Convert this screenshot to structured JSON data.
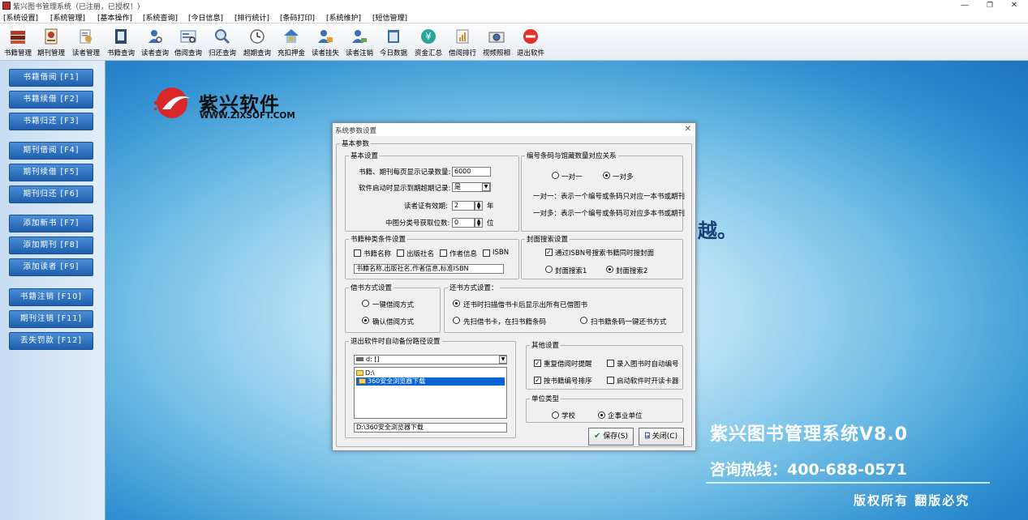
{
  "window": {
    "title": "紫兴图书管理系统（已注册，已授权！）",
    "minimize_glyph": "—",
    "restore_glyph": "❐",
    "close_glyph": "✕"
  },
  "menu": [
    "[系统设置]",
    "[系统管理]",
    "[基本操作]",
    "[系统查询]",
    "[今日信息]",
    "[排行统计]",
    "[条码打印]",
    "[系统维护]",
    "[短信管理]"
  ],
  "toolbar": [
    {
      "label": "书籍管理",
      "icon": "books-icon"
    },
    {
      "label": "期刊管理",
      "icon": "magazine-icon"
    },
    {
      "label": "读者管理",
      "icon": "reader-icon"
    },
    {
      "label": "书籍查询",
      "icon": "book-search-icon"
    },
    {
      "label": "读者查询",
      "icon": "user-search-icon"
    },
    {
      "label": "借阅查询",
      "icon": "borrow-search-icon"
    },
    {
      "label": "归还查询",
      "icon": "magnifier-icon"
    },
    {
      "label": "超期查询",
      "icon": "clock-icon"
    },
    {
      "label": "充扣押金",
      "icon": "money-house-icon"
    },
    {
      "label": "读者挂失",
      "icon": "user-lock-icon"
    },
    {
      "label": "读者注销",
      "icon": "user-cancel-icon"
    },
    {
      "label": "今日数据",
      "icon": "calendar-icon"
    },
    {
      "label": "资金汇总",
      "icon": "yen-icon"
    },
    {
      "label": "借阅排行",
      "icon": "ranking-icon"
    },
    {
      "label": "视频照相",
      "icon": "camera-icon"
    },
    {
      "label": "退出软件",
      "icon": "exit-icon"
    }
  ],
  "shortcuts": [
    "书籍借阅 [F1]",
    "书籍续借 [F2]",
    "书籍归还 [F3]",
    "期刊借阅 [F4]",
    "期刊续借 [F5]",
    "期刊归还 [F6]",
    "添加新书 [F7]",
    "添加期刊 [F8]",
    "添加读者 [F9]",
    "书籍注销 [F10]",
    "期刊注销 [F11]",
    "丢失罚款 [F12]"
  ],
  "background": {
    "logo_name": "紫兴软件",
    "logo_url": "WWW.ZIXSOFT.COM",
    "fragment": "越。",
    "product_title": "紫兴图书管理系统V8.0",
    "hotline": "咨询热线：400-688-0571",
    "copyright": "版权所有  翻版必究"
  },
  "dialog": {
    "title": "系统参数设置",
    "close_glyph": "✕",
    "basic_legend": "基本参数",
    "basic_settings": {
      "legend": "基本设置",
      "page_count_label": "书籍、期刊每页显示记录数量:",
      "page_count_value": "6000",
      "show_overdue_label": "软件启动时显示到期超期记录:",
      "show_overdue_value": "是",
      "valid_years_label": "读者证有效期:",
      "valid_years_value": "2",
      "valid_years_unit": "年",
      "class_digits_label": "中图分类号获取位数:",
      "class_digits_value": "0",
      "class_digits_unit": "位"
    },
    "barcode_mapping": {
      "legend": "编号条码与馆藏数量对应关系",
      "one_to_one": "一对一",
      "one_to_many": "一对多",
      "desc_one": "一对一：表示一个编号或条码只对应一本书或期刊",
      "desc_many": "一对多：表示一个编号或条码可对应多本书或期刊"
    },
    "book_type": {
      "legend": "书籍种类条件设置",
      "options": [
        "书籍名称",
        "出版社名",
        "作者信息",
        "ISBN"
      ],
      "value": "书籍名称,出版社名,作者信息,标准ISBN"
    },
    "cover": {
      "legend": "封面搜索设置",
      "isbn_search": "通过ISBN号搜索书籍同时搜封面",
      "search1": "封面搜索1",
      "search2": "封面搜索2"
    },
    "borrow_mode": {
      "legend": "借书方式设置",
      "one_click": "一键借阅方式",
      "confirm": "确认借阅方式"
    },
    "return_mode": {
      "legend": "还书方式设置：",
      "show_all": "还书时扫描借书卡后显示出所有已借图书",
      "scan_card_first": "先扫借书卡，在扫书籍条码",
      "scan_one_key": "扫书籍条码一键还书方式"
    },
    "backup": {
      "legend": "退出软件时自动备份路径设置",
      "drive": "d: []",
      "tree": [
        "D:\\",
        "360安全浏览器下载"
      ],
      "path": "D:\\360安全浏览器下载"
    },
    "other": {
      "legend": "其他设置",
      "dup_remind": "重复借阅时提醒",
      "auto_number": "录入图书时自动编号",
      "sort_by_number": "按书籍编号排序",
      "open_reader": "启动软件时开读卡器"
    },
    "unit_type": {
      "legend": "单位类型",
      "school": "学校",
      "enterprise": "企事业单位"
    },
    "save_label": "保存(S)",
    "close_label": "关闭(C)"
  }
}
